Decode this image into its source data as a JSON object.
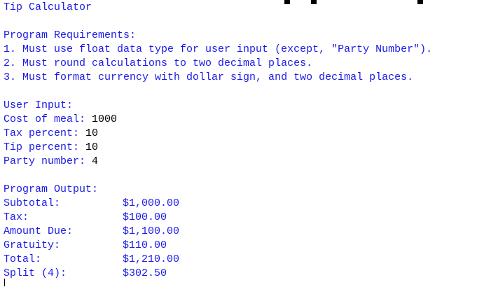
{
  "title": "Tip Calculator",
  "requirements": {
    "heading": "Program Requirements:",
    "items": [
      "1. Must use float data type for user input (except, \"Party Number\").",
      "2. Must round calculations to two decimal places.",
      "3. Must format currency with dollar sign, and two decimal places."
    ]
  },
  "user_input": {
    "heading": "User Input:",
    "fields": [
      {
        "prompt": "Cost of meal: ",
        "value": "1000"
      },
      {
        "prompt": "Tax percent: ",
        "value": "10"
      },
      {
        "prompt": "Tip percent: ",
        "value": "10"
      },
      {
        "prompt": "Party number: ",
        "value": "4"
      }
    ]
  },
  "output": {
    "heading": "Program Output:",
    "rows": [
      {
        "label": "Subtotal:",
        "value": "$1,000.00"
      },
      {
        "label": "Tax:",
        "value": "$100.00"
      },
      {
        "label": "Amount Due:",
        "value": "$1,100.00"
      },
      {
        "label": "Gratuity:",
        "value": "$110.00"
      },
      {
        "label": "Total:",
        "value": "$1,210.00"
      },
      {
        "label": "Split (4):",
        "value": "$302.50"
      }
    ]
  },
  "colors": {
    "program_text": "#1a1ae6",
    "user_text": "#000000",
    "background": "#ffffff"
  }
}
